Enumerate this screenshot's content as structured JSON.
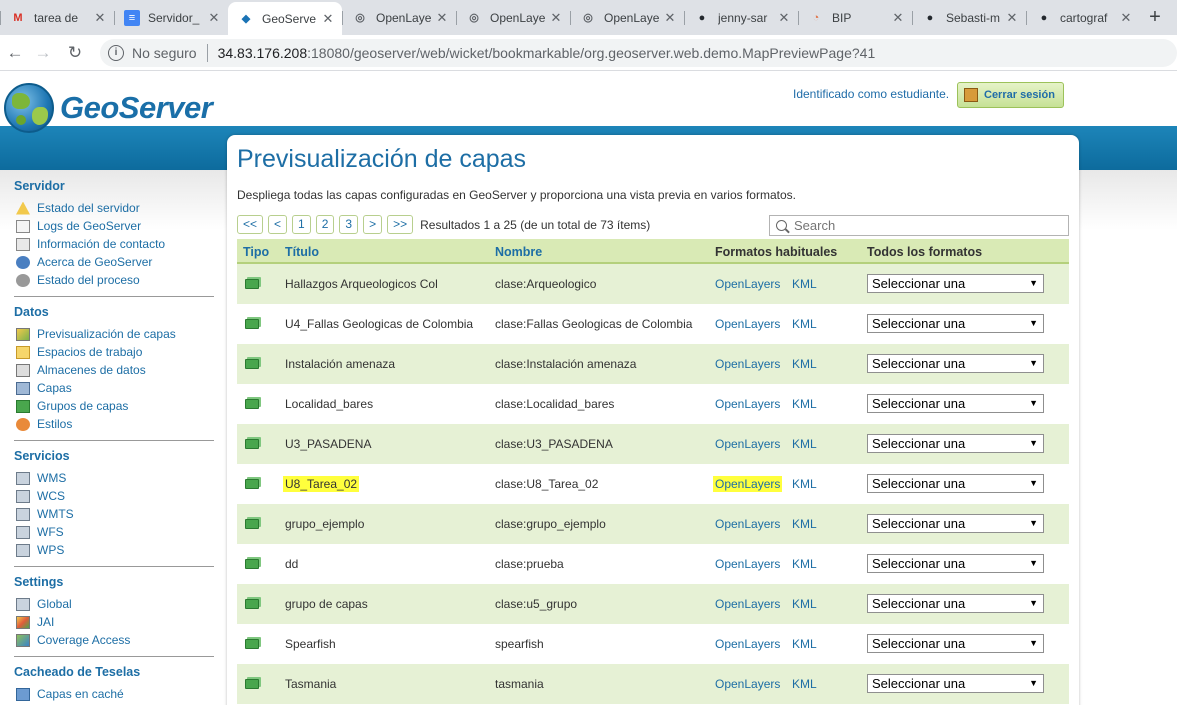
{
  "browser": {
    "tabs": [
      {
        "title": "tarea de",
        "icon": "gmail-icon"
      },
      {
        "title": "Servidor_",
        "icon": "docs-icon"
      },
      {
        "title": "GeoServe",
        "icon": "geoserver-icon",
        "active": true
      },
      {
        "title": "OpenLaye",
        "icon": "globe-icon"
      },
      {
        "title": "OpenLaye",
        "icon": "globe-icon"
      },
      {
        "title": "OpenLaye",
        "icon": "globe-icon"
      },
      {
        "title": "jenny-sar",
        "icon": "github-icon"
      },
      {
        "title": "BIP",
        "icon": "bip-icon"
      },
      {
        "title": "Sebasti-m",
        "icon": "github-icon"
      },
      {
        "title": "cartograf",
        "icon": "github-icon"
      }
    ],
    "new_tab": "+",
    "insecure_label": "No seguro",
    "url_host": "34.83.176.208",
    "url_rest": ":18080/geoserver/web/wicket/bookmarkable/org.geoserver.web.demo.MapPreviewPage?41"
  },
  "header": {
    "brand": "GeoServer",
    "user_text": "Identificado como estudiante.",
    "logout_label": "Cerrar sesión"
  },
  "sidebar": [
    {
      "title": "Servidor",
      "items": [
        {
          "label": "Estado del servidor",
          "icon": "server-status-icon"
        },
        {
          "label": "Logs de GeoServer",
          "icon": "logs-icon"
        },
        {
          "label": "Información de contacto",
          "icon": "contact-icon"
        },
        {
          "label": "Acerca de GeoServer",
          "icon": "about-icon"
        },
        {
          "label": "Estado del proceso",
          "icon": "process-gear-icon"
        }
      ]
    },
    {
      "title": "Datos",
      "items": [
        {
          "label": "Previsualización de capas",
          "icon": "layer-preview-icon"
        },
        {
          "label": "Espacios de trabajo",
          "icon": "folder-icon"
        },
        {
          "label": "Almacenes de datos",
          "icon": "datastore-icon"
        },
        {
          "label": "Capas",
          "icon": "layer-icon"
        },
        {
          "label": "Grupos de capas",
          "icon": "layer-group-icon"
        },
        {
          "label": "Estilos",
          "icon": "styles-icon"
        }
      ]
    },
    {
      "title": "Servicios",
      "items": [
        {
          "label": "WMS",
          "icon": "service-icon"
        },
        {
          "label": "WCS",
          "icon": "service-icon"
        },
        {
          "label": "WMTS",
          "icon": "service-icon"
        },
        {
          "label": "WFS",
          "icon": "service-icon"
        },
        {
          "label": "WPS",
          "icon": "service-icon"
        }
      ]
    },
    {
      "title": "Settings",
      "items": [
        {
          "label": "Global",
          "icon": "global-settings-icon"
        },
        {
          "label": "JAI",
          "icon": "jai-icon"
        },
        {
          "label": "Coverage Access",
          "icon": "coverage-icon"
        }
      ]
    },
    {
      "title": "Cacheado de Teselas",
      "items": [
        {
          "label": "Capas en caché",
          "icon": "cached-layers-icon"
        }
      ]
    }
  ],
  "main": {
    "title": "Previsualización de capas",
    "description": "Despliega todas las capas configuradas en GeoServer y proporciona una vista previa en varios formatos.",
    "pager": {
      "buttons": [
        "<<",
        "<",
        "1",
        "2",
        "3",
        ">",
        ">>"
      ],
      "results": "Resultados 1 a 25 (de un total de 73 ítems)"
    },
    "search_placeholder": "Search",
    "columns": {
      "type": "Tipo",
      "title": "Título",
      "name": "Nombre",
      "common": "Formatos habituales",
      "all": "Todos los formatos"
    },
    "link_openlayers": "OpenLayers",
    "link_kml": "KML",
    "select_default": "Seleccionar una",
    "rows": [
      {
        "title": "Hallazgos Arqueologicos Col",
        "name": "clase:Arqueologico"
      },
      {
        "title": "U4_Fallas Geologicas de Colombia",
        "name": "clase:Fallas Geologicas de Colombia"
      },
      {
        "title": "Instalación amenaza",
        "name": "clase:Instalación amenaza"
      },
      {
        "title": "Localidad_bares",
        "name": "clase:Localidad_bares"
      },
      {
        "title": "U3_PASADENA",
        "name": "clase:U3_PASADENA"
      },
      {
        "title": "U8_Tarea_02",
        "name": "clase:U8_Tarea_02",
        "highlighted": true
      },
      {
        "title": "grupo_ejemplo",
        "name": "clase:grupo_ejemplo"
      },
      {
        "title": "dd",
        "name": "clase:prueba"
      },
      {
        "title": "grupo de capas",
        "name": "clase:u5_grupo"
      },
      {
        "title": "Spearfish",
        "name": "spearfish"
      },
      {
        "title": "Tasmania",
        "name": "tasmania"
      }
    ]
  },
  "colors": {
    "accent": "#1d6ea5",
    "header_band": "#1d85b9",
    "row_alt": "#e6f1d5",
    "highlight": "#ffff3d"
  }
}
